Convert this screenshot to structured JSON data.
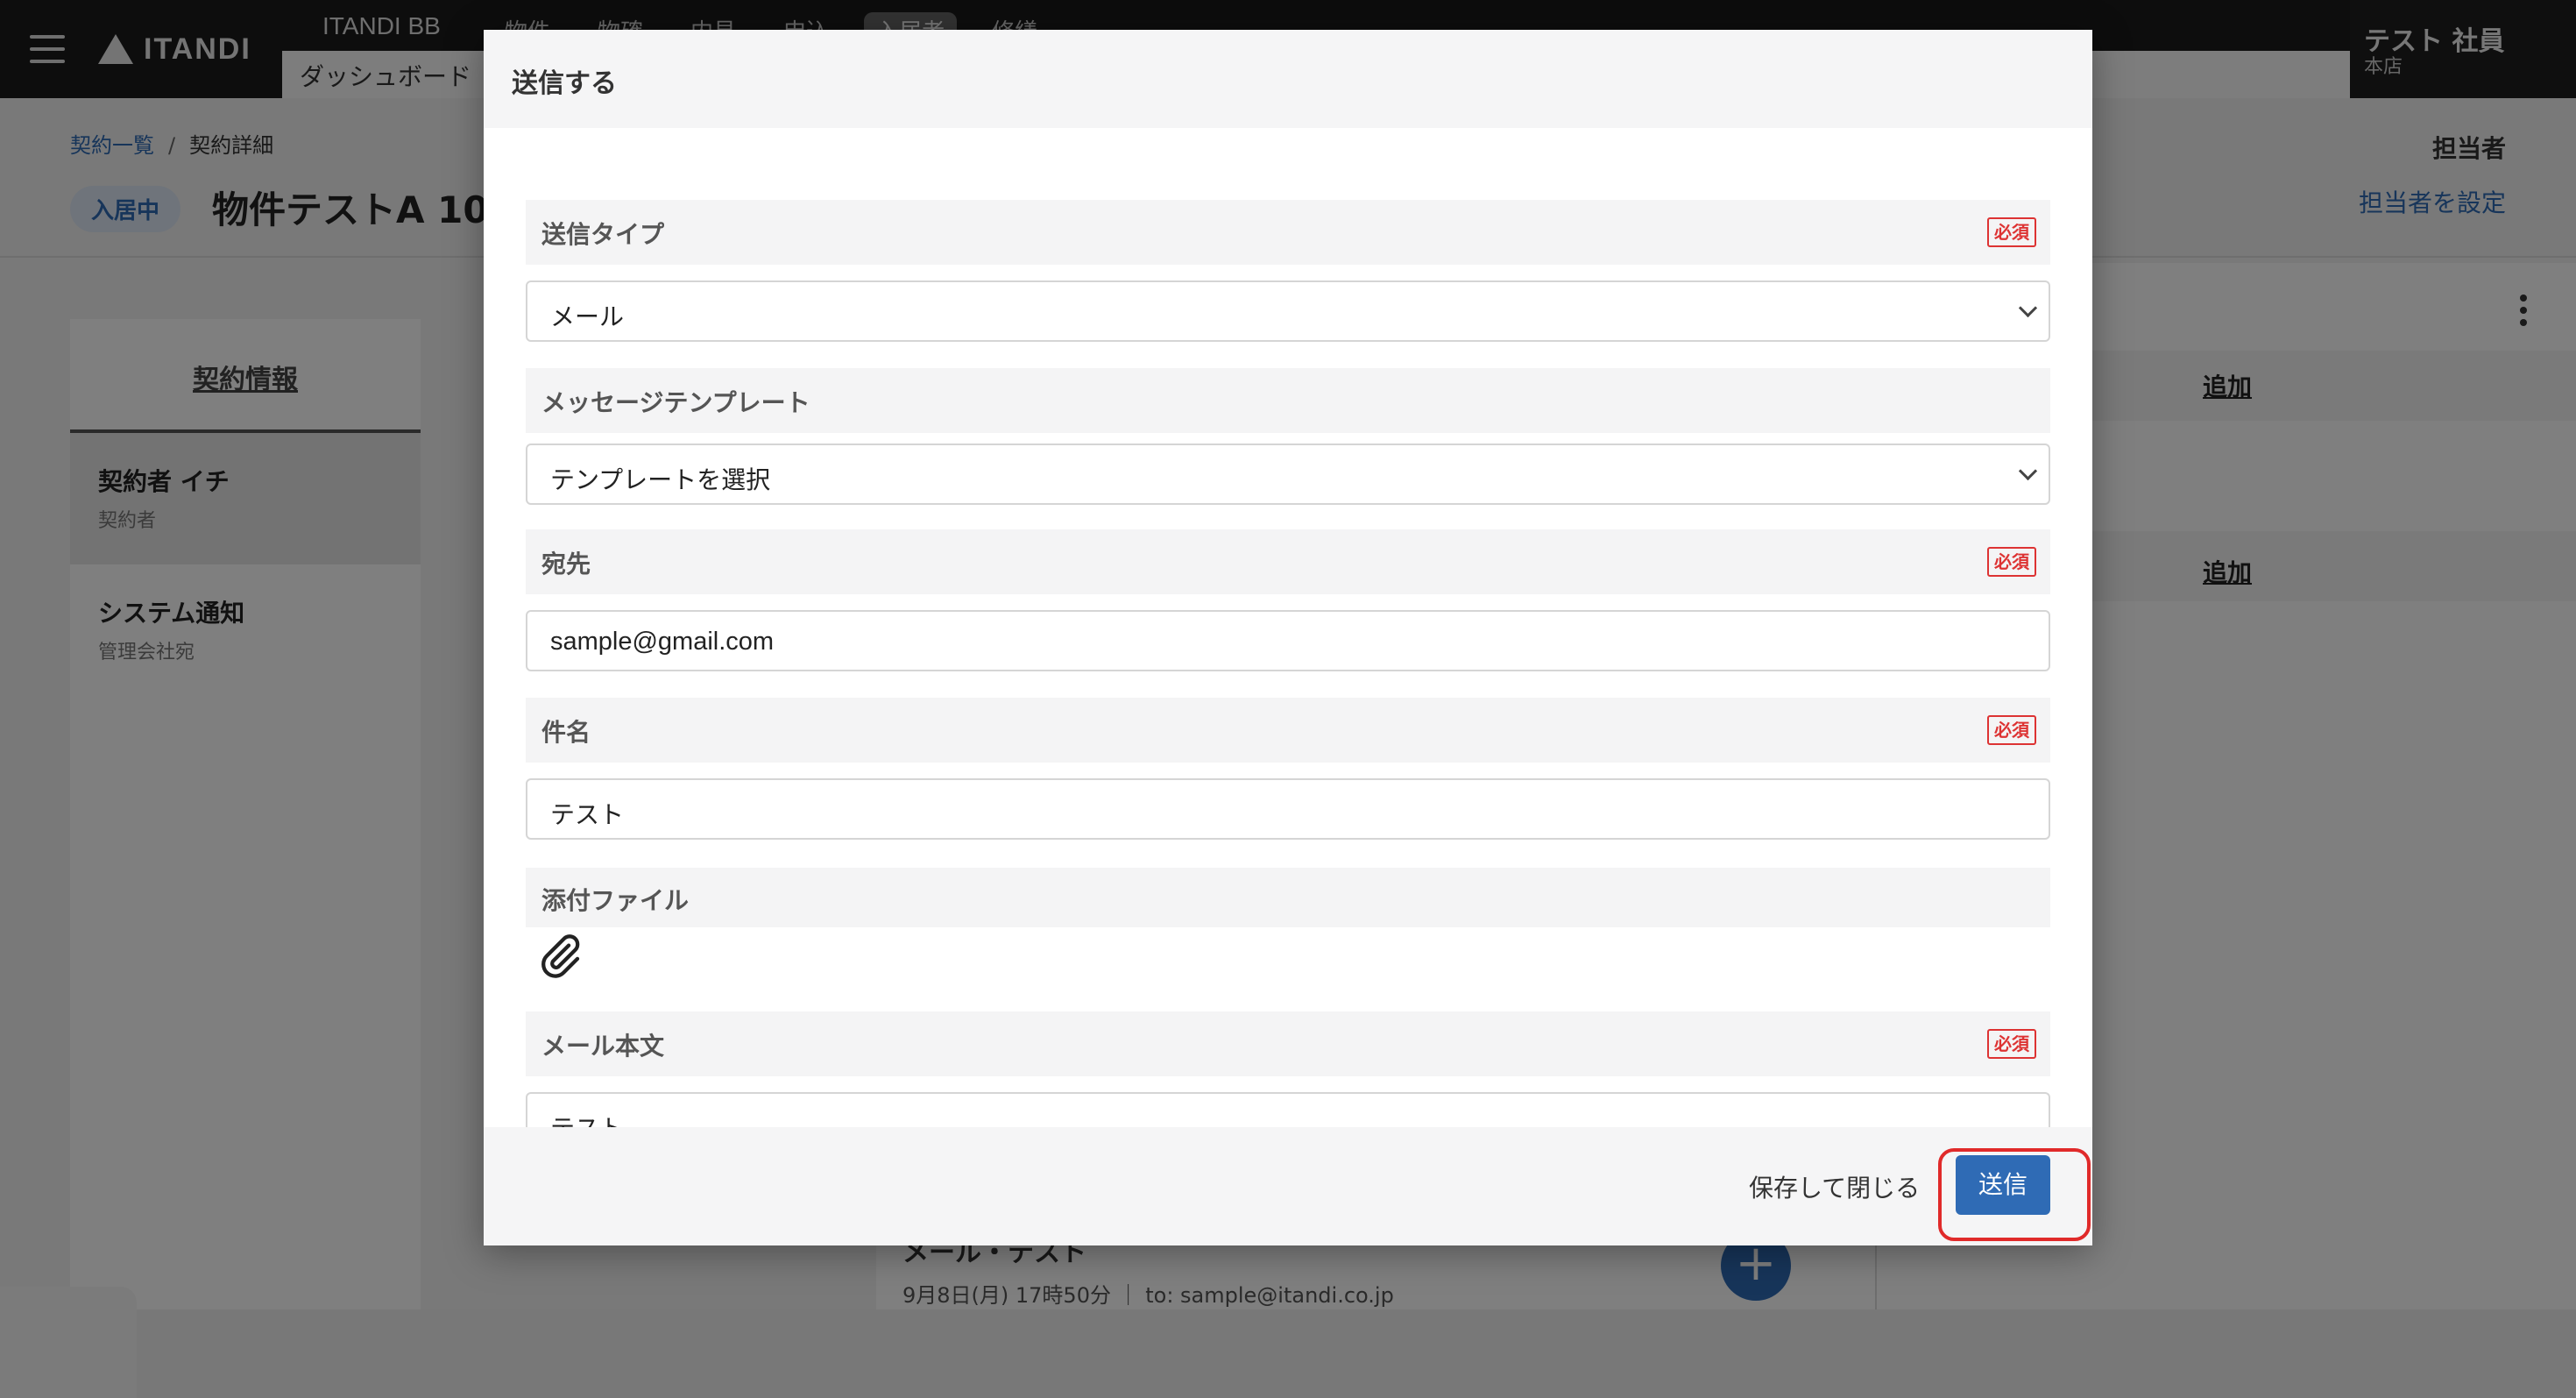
{
  "app": {
    "logo_text": "ITANDI",
    "product_name": "ITANDI BB",
    "nav": [
      "物件",
      "物確",
      "内見",
      "申込",
      "入居者",
      "修繕"
    ],
    "nav_active": "入居者",
    "sub_tab": "ダッシュボード",
    "user_name": "テスト 社員",
    "user_branch": "本店"
  },
  "breadcrumb": {
    "list": "契約一覧",
    "separator": "/",
    "current": "契約詳細"
  },
  "header": {
    "status": "入居中",
    "title": "物件テストA 10",
    "assignee_label": "担当者",
    "assignee_link": "担当者を設定"
  },
  "left_panel": {
    "tab": "契約情報",
    "items": [
      {
        "name": "契約者 イチ",
        "sub": "契約者"
      },
      {
        "name": "システム通知",
        "sub": "管理会社宛"
      }
    ]
  },
  "center_panel": {
    "message_title": "メール・テスト",
    "message_meta": "9月8日(月) 17時50分 ｜ to: sample@itandi.co.jp"
  },
  "right_panel": {
    "add_label_1": "追加",
    "add_label_2": "追加"
  },
  "modal": {
    "title": "送信する",
    "required_badge": "必須",
    "fields": {
      "send_type": {
        "label": "送信タイプ",
        "value": "メール"
      },
      "template": {
        "label": "メッセージテンプレート",
        "value": "テンプレートを選択"
      },
      "to": {
        "label": "宛先",
        "value": "sample@gmail.com"
      },
      "subject": {
        "label": "件名",
        "value": "テスト"
      },
      "attachment": {
        "label": "添付ファイル"
      },
      "body": {
        "label": "メール本文",
        "value": "テスト"
      }
    },
    "footer": {
      "save_close": "保存して閉じる",
      "send": "送信"
    }
  },
  "icons": {
    "menu": "hamburger-icon",
    "attach": "paperclip-icon",
    "more": "kebab-icon",
    "add": "plus-icon"
  },
  "colors": {
    "accent": "#2f6bb5",
    "required": "#dd3333",
    "highlight": "#e02a2a"
  }
}
